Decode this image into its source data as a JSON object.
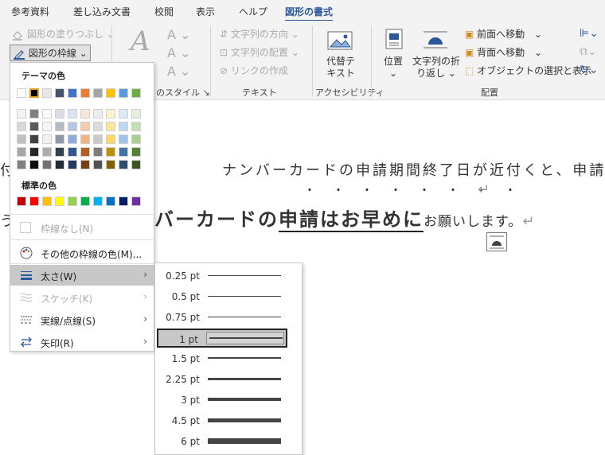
{
  "tabs": [
    {
      "label": "参考資料"
    },
    {
      "label": "差し込み文書"
    },
    {
      "label": "校閲"
    },
    {
      "label": "表示"
    },
    {
      "label": "ヘルプ"
    },
    {
      "label": "図形の書式",
      "active": true
    }
  ],
  "ribbon": {
    "fill_label": "図形の塗りつぶし",
    "outline_label": "図形の枠線",
    "styles_partial_label": "のスタイル",
    "text_direction": "文字列の方向",
    "text_align": "文字列の配置",
    "create_link": "リンクの作成",
    "text_group": "テキスト",
    "alt_text_line1": "代替テ",
    "alt_text_line2": "キスト",
    "accessibility_group": "アクセシビリティ",
    "position_label": "位置",
    "wrap_line1": "文字列の折",
    "wrap_line2": "り返し",
    "bring_forward": "前面へ移動",
    "send_backward": "背面へ移動",
    "selection_pane": "オブジェクトの選択と表示",
    "arrange_group": "配置"
  },
  "document": {
    "line1_prefix": "付",
    "line1_text": "ナンバーカードの申請期間終了日が近付くと、申請が混み",
    "line2_prefix": "う",
    "line2_normal": "バーカードの",
    "line2_emph": "申請はお早めに",
    "line2_tail": "お願いします。",
    "para_mark": "↵",
    "emphasis_dots": "・・・・・・・・"
  },
  "menu": {
    "theme_colors_header": "テーマの色",
    "theme_row": [
      "#ffffff",
      "#000000",
      "#e7e6e6",
      "#44546a",
      "#4472c4",
      "#ed7d31",
      "#a5a5a5",
      "#ffc000",
      "#5b9bd5",
      "#70ad47"
    ],
    "standard_colors_header": "標準の色",
    "standard_row": [
      "#c00000",
      "#ff0000",
      "#ffc000",
      "#ffff00",
      "#92d050",
      "#00b050",
      "#00b0f0",
      "#0070c0",
      "#002060",
      "#7030a0"
    ],
    "no_outline": "枠線なし(N)",
    "more_colors": "その他の枠線の色(M)...",
    "weight": "太さ(W)",
    "sketch": "スケッチ(K)",
    "dashes": "実線/点線(S)",
    "arrows": "矢印(R)"
  },
  "weights": [
    {
      "label": "0.25 pt",
      "thickness": 1
    },
    {
      "label": "0.5 pt",
      "thickness": 1
    },
    {
      "label": "0.75 pt",
      "thickness": 1
    },
    {
      "label": "1 pt",
      "thickness": 1.5,
      "selected": true
    },
    {
      "label": "1.5 pt",
      "thickness": 2
    },
    {
      "label": "2.25 pt",
      "thickness": 3
    },
    {
      "label": "3 pt",
      "thickness": 4
    },
    {
      "label": "4.5 pt",
      "thickness": 5
    },
    {
      "label": "6 pt",
      "thickness": 7
    }
  ]
}
